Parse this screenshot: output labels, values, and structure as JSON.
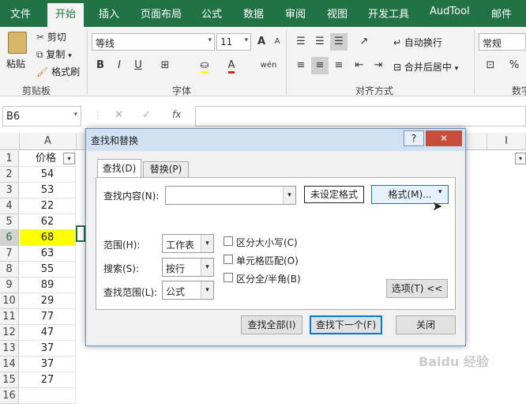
{
  "ribbon_tabs": [
    "文件",
    "开始",
    "插入",
    "页面布局",
    "公式",
    "数据",
    "审阅",
    "视图",
    "开发工具",
    "AudTool",
    "邮件"
  ],
  "clipboard": {
    "paste": "粘贴",
    "cut": "剪切",
    "copy": "复制",
    "format_painter": "格式刷",
    "label": "剪贴板"
  },
  "font": {
    "name": "等线",
    "size": "11",
    "label": "字体",
    "bold": "B",
    "italic": "I",
    "underline": "U",
    "grow": "A",
    "shrink": "A",
    "phonetic": "wén"
  },
  "alignment": {
    "wrap": "自动换行",
    "merge": "合并后居中",
    "label": "对齐方式"
  },
  "number": {
    "format": "常规",
    "percent": "%",
    "label": "数字"
  },
  "formula_bar": {
    "name_box": "B6",
    "fx": "fx",
    "content": ""
  },
  "sheet": {
    "columns": [
      "A",
      "I"
    ],
    "header_cell": "价格",
    "rows": [
      {
        "num": "1",
        "value": "价格"
      },
      {
        "num": "2",
        "value": "54"
      },
      {
        "num": "3",
        "value": "53"
      },
      {
        "num": "4",
        "value": "22"
      },
      {
        "num": "5",
        "value": "62"
      },
      {
        "num": "6",
        "value": "68"
      },
      {
        "num": "7",
        "value": "63"
      },
      {
        "num": "8",
        "value": "55"
      },
      {
        "num": "9",
        "value": "89"
      },
      {
        "num": "10",
        "value": "29"
      },
      {
        "num": "11",
        "value": "77"
      },
      {
        "num": "12",
        "value": "47"
      },
      {
        "num": "13",
        "value": "37"
      },
      {
        "num": "14",
        "value": "37"
      },
      {
        "num": "15",
        "value": "27"
      },
      {
        "num": "16",
        "value": ""
      }
    ],
    "highlight_color": "#ffff00"
  },
  "dialog": {
    "title": "查找和替换",
    "help": "?",
    "close": "✕",
    "tab_find": "查找(D)",
    "tab_replace": "替换(P)",
    "find_label": "查找内容(N):",
    "find_value": "",
    "format_preview": "未设定格式",
    "format_button": "格式(M)...",
    "scope_label": "范围(H):",
    "scope_value": "工作表",
    "search_label": "搜索(S):",
    "search_value": "按行",
    "lookin_label": "查找范围(L):",
    "lookin_value": "公式",
    "match_case": "区分大小写(C)",
    "match_cell": "单元格匹配(O)",
    "match_width": "区分全/半角(B)",
    "options_button": "选项(T) <<",
    "find_all": "查找全部(I)",
    "find_next": "查找下一个(F)",
    "close_button": "关闭"
  },
  "watermark": "Baidu 经验"
}
